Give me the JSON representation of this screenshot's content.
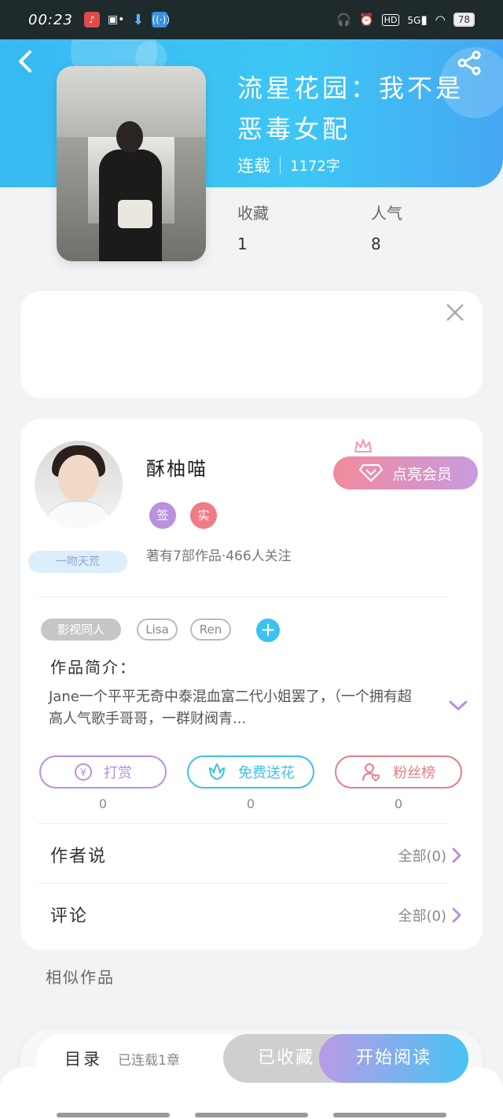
{
  "status_bar": {
    "time": "00:23",
    "battery": "78",
    "network": "5G"
  },
  "book": {
    "title": "流星花园：我不是恶毒女配",
    "status": "连载",
    "word_count": "1172字",
    "favorites_label": "收藏",
    "favorites_value": "1",
    "popularity_label": "人气",
    "popularity_value": "8"
  },
  "author": {
    "name": "酥柚喵",
    "badge_sign": "签",
    "badge_real": "实",
    "ribbon": "一吻天荒",
    "stats": "著有7部作品·466人关注",
    "vip_button": "点亮会员"
  },
  "tags": [
    "影视同人",
    "Lisa",
    "Ren"
  ],
  "intro": {
    "label": "作品简介：",
    "text": "Jane一个平平无奇中泰混血富二代小姐罢了，（一个拥有超高人气歌手哥哥，一群财阀青..."
  },
  "actions": [
    {
      "label": "打赏",
      "count": "0",
      "color": "#b991dd"
    },
    {
      "label": "免费送花",
      "count": "0",
      "color": "#3ec1e8"
    },
    {
      "label": "粉丝榜",
      "count": "0",
      "color": "#e97c86"
    }
  ],
  "rows": {
    "author_says": {
      "label": "作者说",
      "link": "全部(0)"
    },
    "comments": {
      "label": "评论",
      "link": "全部(0)"
    }
  },
  "similar_label": "相似作品",
  "bottom": {
    "toc_label": "目录",
    "toc_status": "已连载1章",
    "collected": "已收藏",
    "start_reading": "开始阅读"
  },
  "colors": {
    "header_gradient_start": "#37b9f1",
    "header_gradient_end": "#46a7f2",
    "vip_gradient_start": "#f28a9c",
    "vip_gradient_end": "#c79be0",
    "accent_blue": "#3cc2ef"
  }
}
